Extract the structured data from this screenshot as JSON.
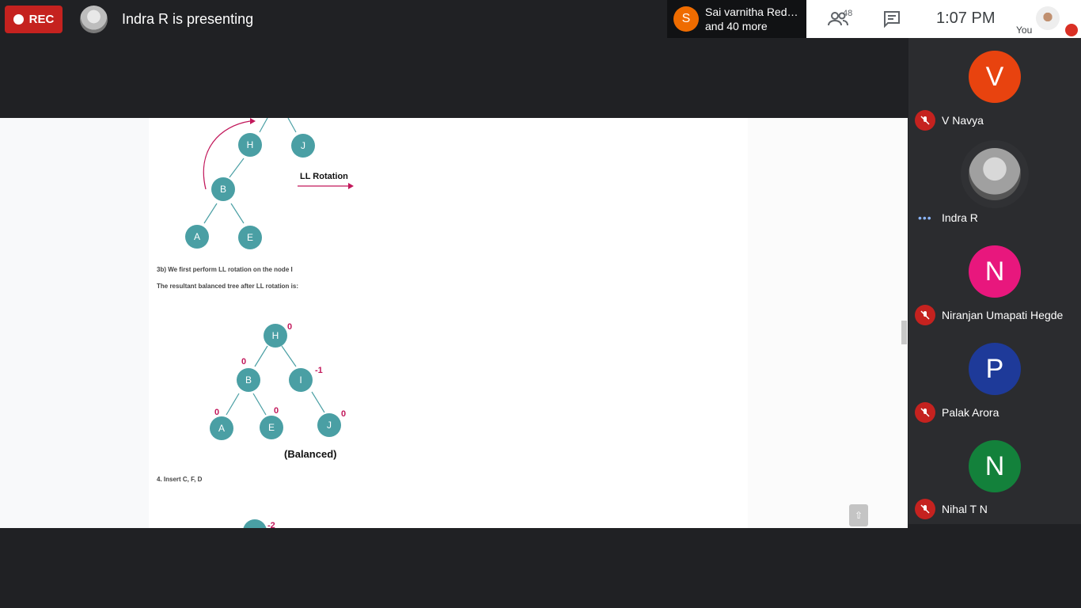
{
  "topbar": {
    "rec_label": "REC",
    "presenting_text": "Indra R is presenting",
    "joiner_initial": "S",
    "joiner_line1": "Sai varnitha Red…",
    "joiner_line2": "and 40 more",
    "participant_count": "48",
    "time": "1:07 PM",
    "you_label": "You"
  },
  "slide": {
    "ll_rotation_label": "LL Rotation",
    "step_3b": "3b) We first perform LL rotation on the node I",
    "resultant_text": "The resultant balanced tree after LL rotation is:",
    "balanced_label": "(Balanced)",
    "step_4": "4. Insert C, F, D",
    "top_tree_nodes": [
      "H",
      "J",
      "B",
      "A",
      "E"
    ],
    "balanced_tree_nodes": [
      "H",
      "B",
      "I",
      "A",
      "E",
      "J"
    ],
    "balance_factors": [
      "0",
      "0",
      "-1",
      "0",
      "0",
      "0"
    ],
    "partial_bf": "-2",
    "node_color": "#4a9fa4",
    "accent_color": "#c2185b"
  },
  "participants": [
    {
      "initial": "V",
      "name": "V Navya",
      "color": "#e8430f",
      "muted": true
    },
    {
      "initial": "",
      "name": "Indra R",
      "color": "#9e9e9e",
      "muted": false
    },
    {
      "initial": "N",
      "name": "Niranjan Umapati Hegde",
      "color": "#e8177d",
      "muted": true
    },
    {
      "initial": "P",
      "name": "Palak Arora",
      "color": "#1e3a99",
      "muted": true
    },
    {
      "initial": "N",
      "name": "Nihal T N",
      "color": "#13813b",
      "muted": true
    }
  ]
}
